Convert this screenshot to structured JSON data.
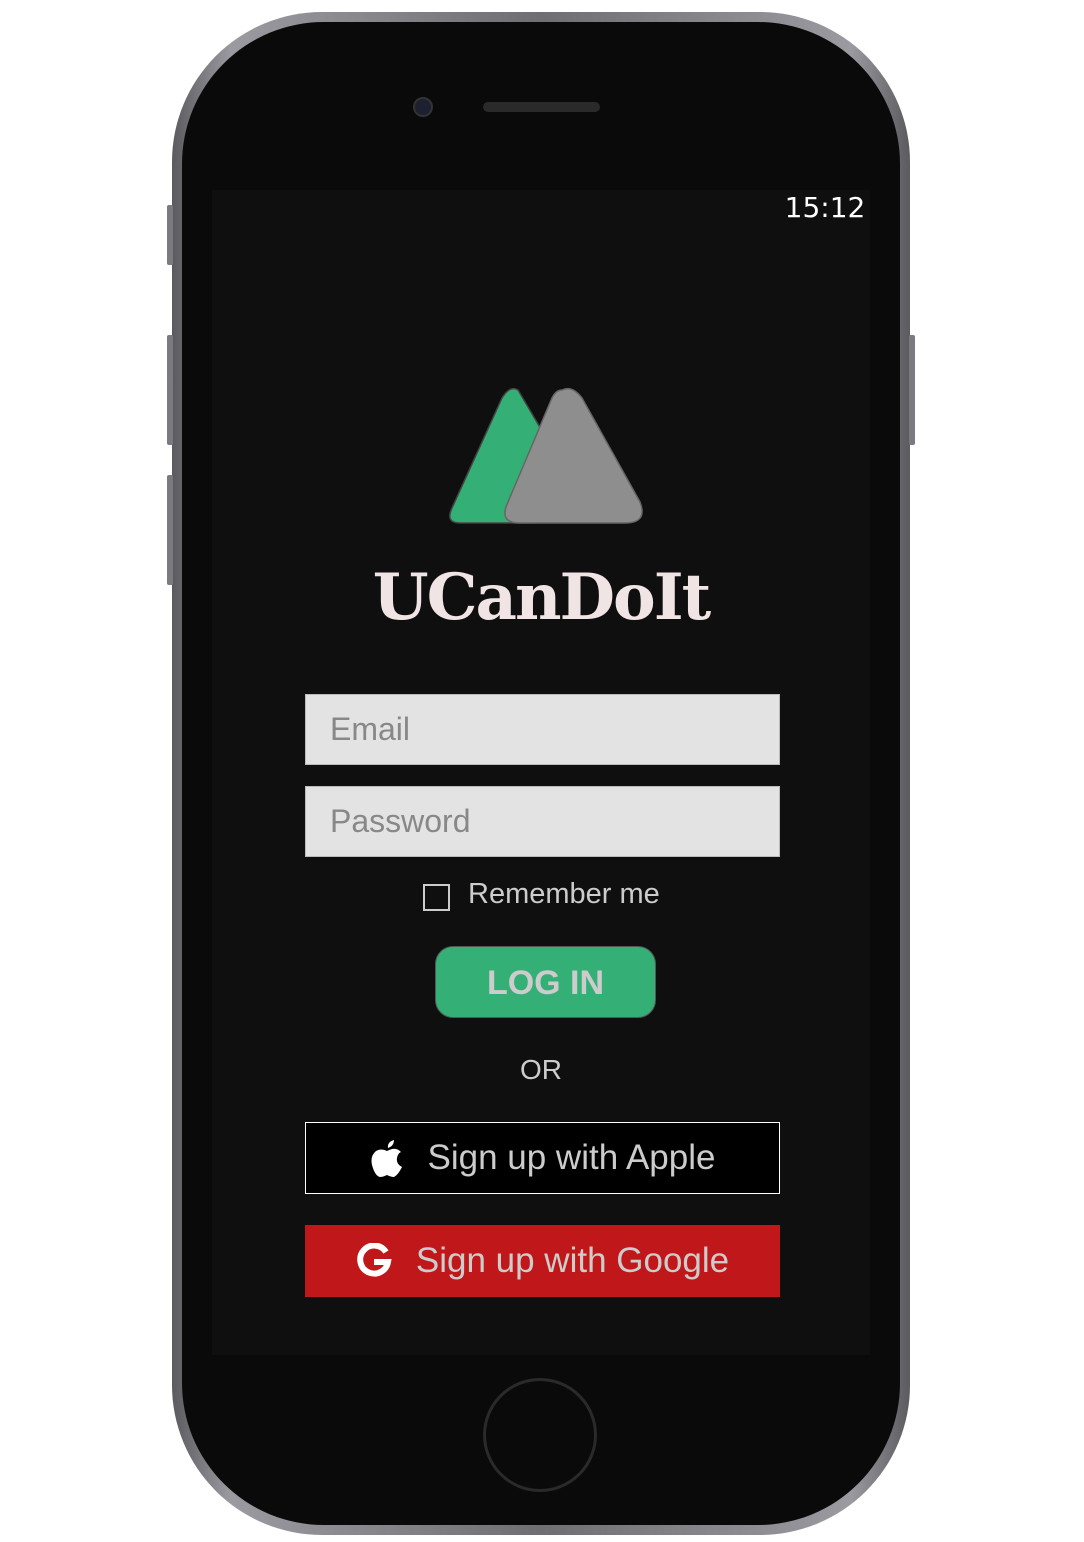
{
  "status_bar": {
    "time": "15:12"
  },
  "app": {
    "name": "UCanDoIt"
  },
  "form": {
    "email_placeholder": "Email",
    "password_placeholder": "Password",
    "remember_label": "Remember me",
    "remember_checked": false,
    "login_label": "LOG IN",
    "or_label": "OR",
    "apple_label": "Sign up with Apple",
    "google_label": "Sign up with Google"
  },
  "colors": {
    "accent": "#34b077",
    "google": "#c0181a",
    "logo_grey": "#8e8e8e",
    "background": "#0f0f0f"
  }
}
